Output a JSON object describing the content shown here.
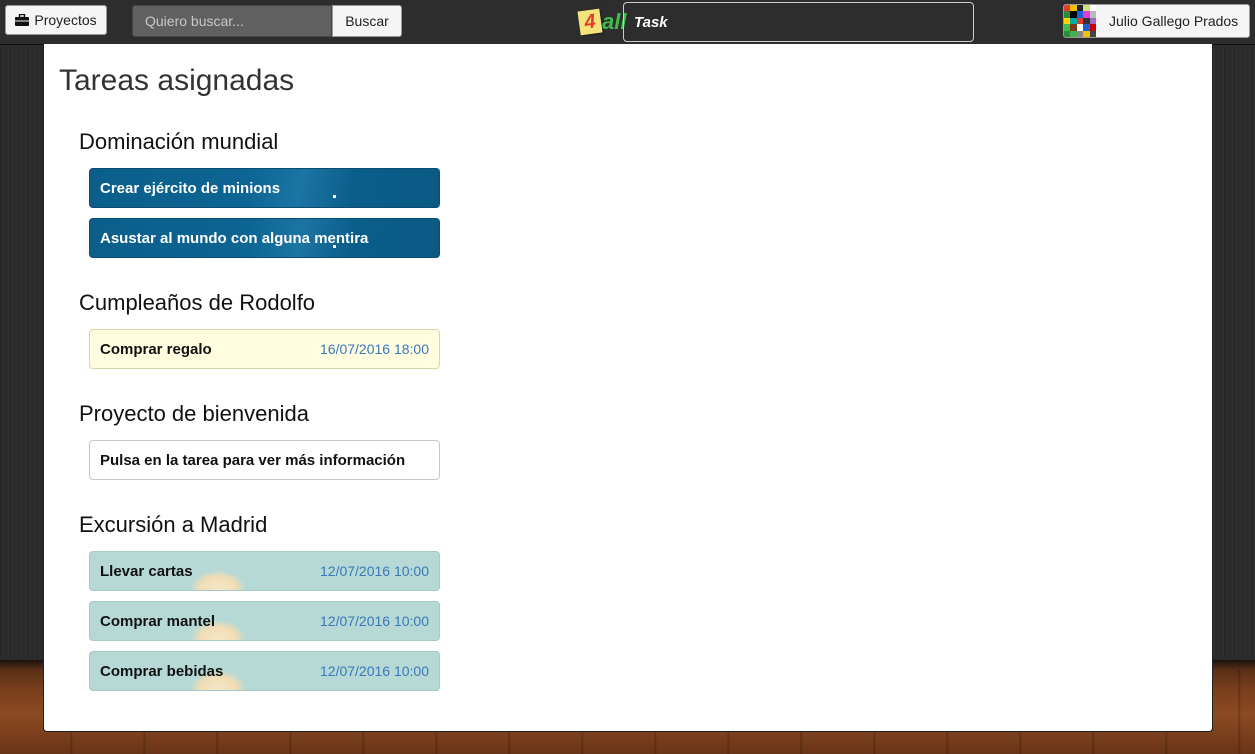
{
  "navbar": {
    "projects_label": "Proyectos",
    "projects_icon": "briefcase-icon",
    "search_placeholder": "Quiero buscar...",
    "search_button": "Buscar",
    "logo": {
      "part1": "Task",
      "part2": "4",
      "part3": "all"
    },
    "user_name": "Julio Gallego Prados"
  },
  "main": {
    "title": "Tareas asignadas",
    "groups": [
      {
        "name": "Dominación mundial",
        "tasks": [
          {
            "name": "Crear ejército de minions",
            "date": ""
          },
          {
            "name": "Asustar al mundo con alguna mentira",
            "date": ""
          }
        ]
      },
      {
        "name": "Cumpleaños de Rodolfo",
        "tasks": [
          {
            "name": "Comprar regalo",
            "date": "16/07/2016 18:00"
          }
        ]
      },
      {
        "name": "Proyecto de bienvenida",
        "tasks": [
          {
            "name": "Pulsa en la tarea para ver más información",
            "date": ""
          }
        ]
      },
      {
        "name": "Excursión a Madrid",
        "tasks": [
          {
            "name": "Llevar cartas",
            "date": "12/07/2016 10:00"
          },
          {
            "name": "Comprar mantel",
            "date": "12/07/2016 10:00"
          },
          {
            "name": "Comprar bebidas",
            "date": "12/07/2016 10:00"
          }
        ]
      }
    ]
  },
  "colors": {
    "task_blue": "#0b5e8a",
    "task_yellow": "#fffde0",
    "task_teal": "#b6d9d6",
    "date_text": "#3a78b8"
  }
}
